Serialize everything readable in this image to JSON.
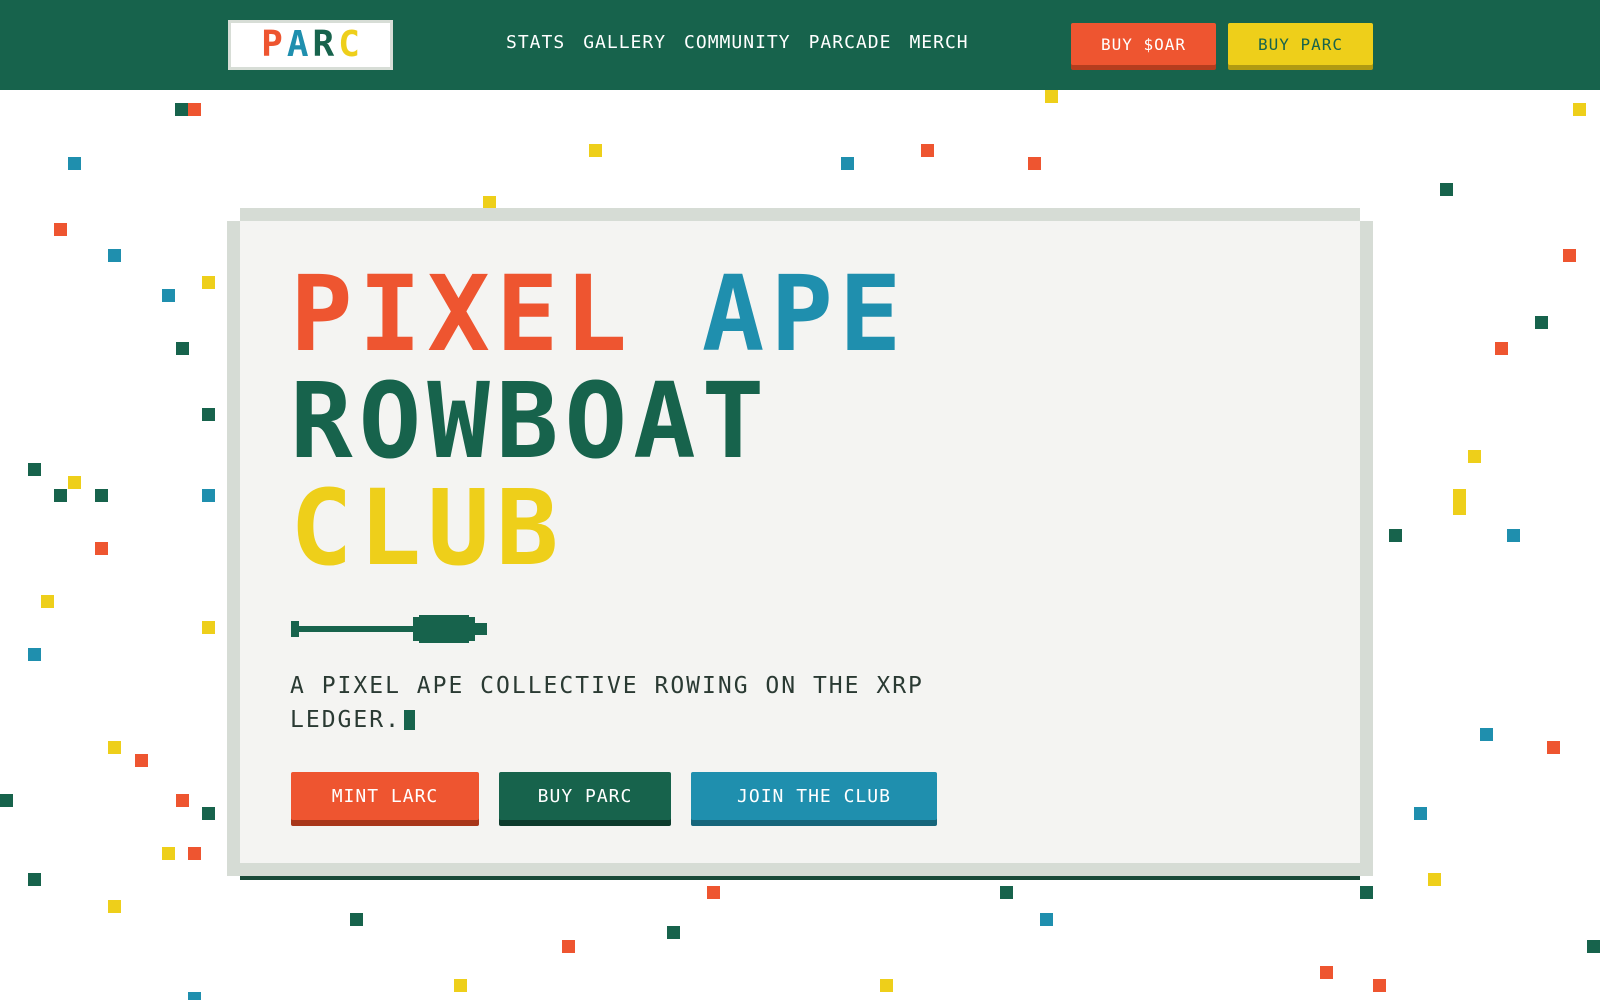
{
  "header": {
    "logo_letters": [
      {
        "char": "P",
        "color": "#ee5530"
      },
      {
        "char": "A",
        "color": "#1f8fae"
      },
      {
        "char": "R",
        "color": "#17634c"
      },
      {
        "char": "C",
        "color": "#eecf1a"
      }
    ],
    "nav": [
      "STATS",
      "GALLERY",
      "COMMUNITY",
      "PARCADE",
      "MERCH"
    ],
    "buy_oar_label": "BUY $OAR",
    "buy_parc_label": "BUY PARC"
  },
  "hero": {
    "title_lines": [
      [
        {
          "text": "PIXEL",
          "color": "#ee5530"
        },
        {
          "text": "APE",
          "color": "#1f8fae"
        }
      ],
      [
        {
          "text": "ROWBOAT",
          "color": "#17634c"
        }
      ],
      [
        {
          "text": "CLUB",
          "color": "#eecf1a"
        }
      ]
    ],
    "tagline": "A PIXEL APE COLLECTIVE ROWING ON THE XRP LEDGER.",
    "oar_icon": "oar-icon",
    "cta": {
      "mint_label": "MINT LARC",
      "buy_label": "BUY PARC",
      "join_label": "JOIN THE CLUB"
    }
  },
  "colors": {
    "brand_green": "#17634c",
    "orange": "#ee5530",
    "blue": "#1f8fae",
    "yellow": "#eecf1a",
    "card_bg": "#f4f4f2",
    "card_border": "#d6dcd5"
  }
}
